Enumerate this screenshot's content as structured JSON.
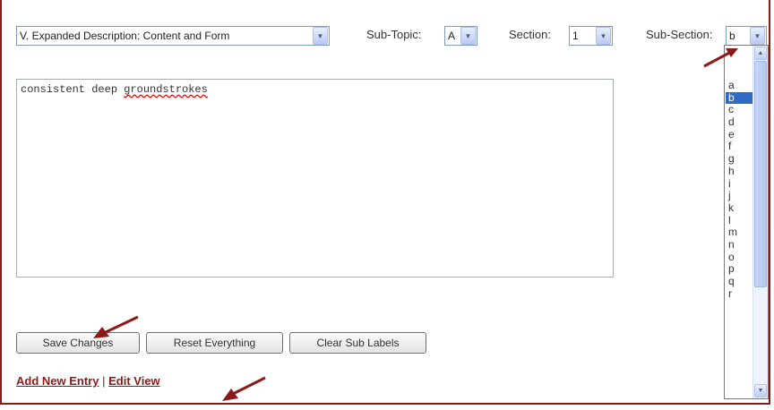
{
  "topic_select": {
    "value": "V. Expanded Description: Content and Form"
  },
  "subtopic": {
    "label": "Sub-Topic:",
    "value": "A"
  },
  "section": {
    "label": "Section:",
    "value": "1"
  },
  "subsection": {
    "label": "Sub-Section:",
    "value": "b"
  },
  "subsection_options": [
    "a",
    "b",
    "c",
    "d",
    "e",
    "f",
    "g",
    "h",
    "i",
    "j",
    "k",
    "l",
    "m",
    "n",
    "o",
    "p",
    "q",
    "r"
  ],
  "subsection_selected_index": 1,
  "editor": {
    "text_plain": "consistent deep ",
    "text_misspelled": "groundstrokes"
  },
  "buttons": {
    "save": "Save Changes",
    "reset": "Reset Everything",
    "clear": "Clear Sub Labels"
  },
  "links": {
    "add": "Add New Entry",
    "separator": "|",
    "edit": "Edit View"
  },
  "colors": {
    "accent": "#8b1a1a",
    "selection": "#316ac5"
  }
}
